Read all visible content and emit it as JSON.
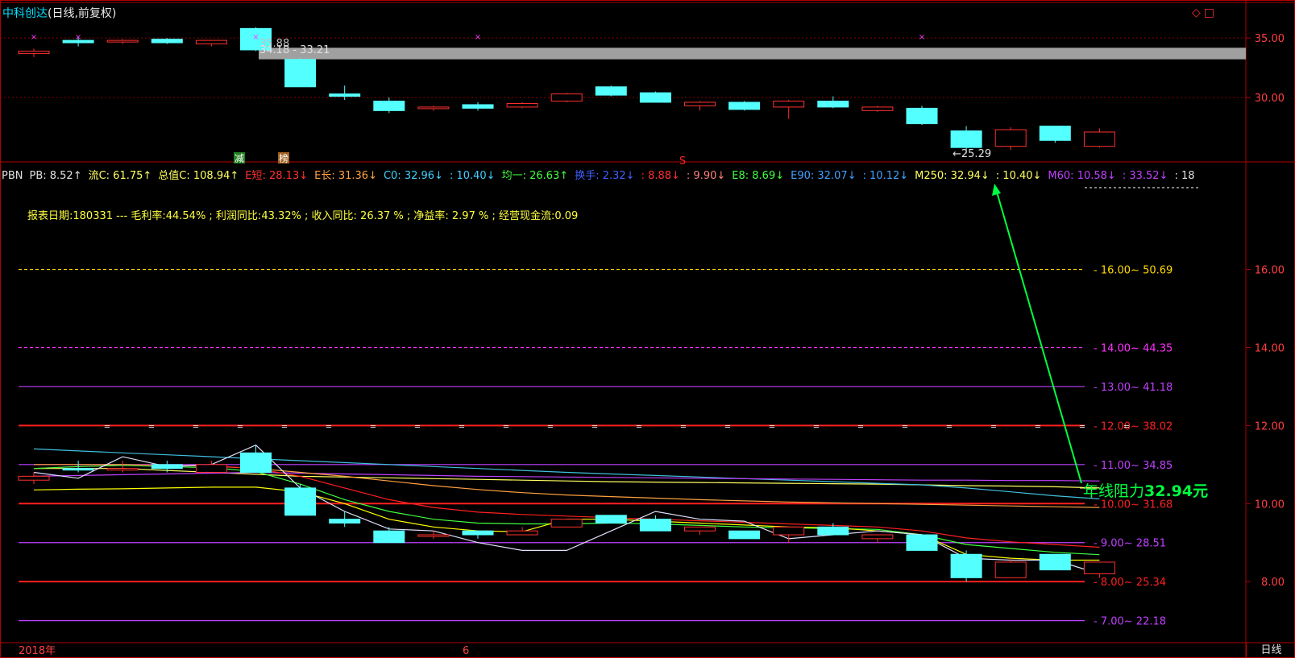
{
  "header": {
    "stock_name": "中科创达",
    "chart_mode": "(日线,前复权)",
    "icons": [
      "diamond-icon",
      "square-icon"
    ]
  },
  "price_scale": {
    "upper_ticks": [
      "35.00",
      "30.00"
    ],
    "lower_ticks": [
      "16.00",
      "14.00",
      "12.00",
      "10.00",
      "8.00"
    ]
  },
  "indicators": [
    {
      "text": "PBN",
      "color": "#e0e0e0"
    },
    {
      "text": "PB: 8.52↑",
      "color": "#e0e0e0"
    },
    {
      "text": "流C: 61.75↑",
      "color": "#ffff60"
    },
    {
      "text": "总值C: 108.94↑",
      "color": "#ffff60"
    },
    {
      "text": "E短: 28.13↓",
      "color": "#ff3030"
    },
    {
      "text": "E长: 31.36↓",
      "color": "#ffa040"
    },
    {
      "text": "C0: 32.96↓",
      "color": "#40d0ff"
    },
    {
      "text": ": 10.40↓",
      "color": "#40d0ff"
    },
    {
      "text": "均一: 26.63↑",
      "color": "#40ff40"
    },
    {
      "text": "换手: 2.32↓",
      "color": "#4060ff"
    },
    {
      "text": ": 8.88↓",
      "color": "#ff3030"
    },
    {
      "text": ": 9.90↓",
      "color": "#ff8080"
    },
    {
      "text": "E8: 8.69↓",
      "color": "#40ff40"
    },
    {
      "text": "E90: 32.07↓",
      "color": "#40a0ff"
    },
    {
      "text": ": 10.12↓",
      "color": "#40a0ff"
    },
    {
      "text": "M250: 32.94↓",
      "color": "#ffff60"
    },
    {
      "text": ": 10.40↓",
      "color": "#ffff60"
    },
    {
      "text": "M60: 10.58↓",
      "color": "#c040ff"
    },
    {
      "text": ": 33.52↓",
      "color": "#c040ff"
    },
    {
      "text": ": 18",
      "color": "#e0e0e0"
    }
  ],
  "report_line": "报表日期:180331 --- 毛利率:44.54% ; 利润同比:43.32% ; 收入同比: 26.37 % ; 净益率: 2.97 % ; 经营现金流:0.09",
  "annotation": {
    "prefix": "年线阻力",
    "value": "32.94元"
  },
  "marks": {
    "reduce": "减",
    "rank": "榜",
    "signal": "S"
  },
  "price_labels": {
    "high": "35.88",
    "range": "34.18 - 33.21",
    "low": "←25.29"
  },
  "time_axis": {
    "year": "2018年",
    "month": "6"
  },
  "period_button": "日线",
  "level_lines": [
    {
      "label": "16.00~ 50.69",
      "color": "#ffd700",
      "style": "dashed"
    },
    {
      "label": "14.00~ 44.35",
      "color": "#ff30ff",
      "style": "dashed"
    },
    {
      "label": "13.00~ 41.18",
      "color": "#c040ff",
      "style": "solid"
    },
    {
      "label": "12.00~ 38.02",
      "color": "#ff2020",
      "style": "solid"
    },
    {
      "label": "11.00~ 34.85",
      "color": "#c040ff",
      "style": "solid"
    },
    {
      "label": "10.00~ 31.68",
      "color": "#ff2020",
      "style": "solid"
    },
    {
      "label": "9.00~ 28.51",
      "color": "#c040ff",
      "style": "solid"
    },
    {
      "label": "8.00~ 25.34",
      "color": "#ff2020",
      "style": "solid"
    },
    {
      "label": "7.00~ 22.18",
      "color": "#c040ff",
      "style": "solid"
    }
  ],
  "chart_data": [
    {
      "type": "candlestick",
      "panel": "price",
      "ylim": [
        25,
        36.5
      ],
      "candles": [
        {
          "o": 33.9,
          "h": 34.1,
          "l": 33.4,
          "c": 33.7,
          "dir": "up"
        },
        {
          "o": 34.8,
          "h": 35.0,
          "l": 34.3,
          "c": 34.6,
          "dir": "down"
        },
        {
          "o": 34.8,
          "h": 34.9,
          "l": 34.5,
          "c": 34.7,
          "dir": "up"
        },
        {
          "o": 34.9,
          "h": 35.0,
          "l": 34.5,
          "c": 34.6,
          "dir": "down"
        },
        {
          "o": 34.5,
          "h": 34.8,
          "l": 34.3,
          "c": 34.8,
          "dir": "up"
        },
        {
          "o": 35.8,
          "h": 35.9,
          "l": 33.9,
          "c": 34.0,
          "dir": "down"
        },
        {
          "o": 33.2,
          "h": 33.3,
          "l": 30.9,
          "c": 30.9,
          "dir": "down"
        },
        {
          "o": 30.3,
          "h": 31.0,
          "l": 29.8,
          "c": 30.1,
          "dir": "down"
        },
        {
          "o": 29.7,
          "h": 30.0,
          "l": 28.7,
          "c": 28.9,
          "dir": "down"
        },
        {
          "o": 29.1,
          "h": 29.3,
          "l": 28.9,
          "c": 29.2,
          "dir": "up"
        },
        {
          "o": 29.4,
          "h": 29.6,
          "l": 28.9,
          "c": 29.1,
          "dir": "down"
        },
        {
          "o": 29.2,
          "h": 29.6,
          "l": 29.1,
          "c": 29.5,
          "dir": "up"
        },
        {
          "o": 29.7,
          "h": 30.4,
          "l": 29.6,
          "c": 30.3,
          "dir": "up"
        },
        {
          "o": 30.9,
          "h": 31.0,
          "l": 30.1,
          "c": 30.2,
          "dir": "down"
        },
        {
          "o": 30.4,
          "h": 30.5,
          "l": 29.6,
          "c": 29.6,
          "dir": "down"
        },
        {
          "o": 29.3,
          "h": 29.7,
          "l": 28.9,
          "c": 29.6,
          "dir": "up"
        },
        {
          "o": 29.6,
          "h": 29.7,
          "l": 28.9,
          "c": 29.0,
          "dir": "down"
        },
        {
          "o": 29.2,
          "h": 29.8,
          "l": 28.2,
          "c": 29.7,
          "dir": "up"
        },
        {
          "o": 29.7,
          "h": 30.1,
          "l": 29.1,
          "c": 29.2,
          "dir": "down"
        },
        {
          "o": 28.9,
          "h": 29.3,
          "l": 28.8,
          "c": 29.2,
          "dir": "up"
        },
        {
          "o": 29.1,
          "h": 29.3,
          "l": 27.7,
          "c": 27.8,
          "dir": "down"
        },
        {
          "o": 27.2,
          "h": 27.6,
          "l": 25.3,
          "c": 25.8,
          "dir": "down"
        },
        {
          "o": 25.9,
          "h": 27.5,
          "l": 25.6,
          "c": 27.3,
          "dir": "up"
        },
        {
          "o": 27.6,
          "h": 27.6,
          "l": 26.2,
          "c": 26.4,
          "dir": "down"
        },
        {
          "o": 25.9,
          "h": 27.4,
          "l": 25.8,
          "c": 27.1,
          "dir": "up"
        }
      ],
      "series": [
        {
          "name": "M250",
          "values": [
            33.21,
            34.18
          ]
        }
      ]
    },
    {
      "type": "candlestick",
      "panel": "pb",
      "ylim": [
        6.6,
        18.2
      ],
      "candles": [
        {
          "o": 10.6,
          "h": 10.8,
          "l": 10.5,
          "c": 10.7,
          "dir": "up"
        },
        {
          "o": 10.9,
          "h": 11.1,
          "l": 10.8,
          "c": 10.9,
          "dir": "down"
        },
        {
          "o": 10.9,
          "h": 11.1,
          "l": 10.8,
          "c": 10.9,
          "dir": "up"
        },
        {
          "o": 11.0,
          "h": 11.1,
          "l": 10.8,
          "c": 10.9,
          "dir": "down"
        },
        {
          "o": 10.8,
          "h": 11.1,
          "l": 10.8,
          "c": 11.0,
          "dir": "up"
        },
        {
          "o": 11.3,
          "h": 11.5,
          "l": 10.8,
          "c": 10.8,
          "dir": "down"
        },
        {
          "o": 10.4,
          "h": 10.5,
          "l": 9.7,
          "c": 9.7,
          "dir": "down"
        },
        {
          "o": 9.6,
          "h": 9.8,
          "l": 9.4,
          "c": 9.5,
          "dir": "down"
        },
        {
          "o": 9.3,
          "h": 9.4,
          "l": 9.0,
          "c": 9.0,
          "dir": "down"
        },
        {
          "o": 9.2,
          "h": 9.3,
          "l": 9.1,
          "c": 9.2,
          "dir": "up"
        },
        {
          "o": 9.3,
          "h": 9.3,
          "l": 9.1,
          "c": 9.2,
          "dir": "down"
        },
        {
          "o": 9.2,
          "h": 9.4,
          "l": 9.2,
          "c": 9.3,
          "dir": "up"
        },
        {
          "o": 9.4,
          "h": 9.6,
          "l": 9.4,
          "c": 9.6,
          "dir": "up"
        },
        {
          "o": 9.7,
          "h": 9.7,
          "l": 9.5,
          "c": 9.5,
          "dir": "down"
        },
        {
          "o": 9.6,
          "h": 9.7,
          "l": 9.3,
          "c": 9.3,
          "dir": "down"
        },
        {
          "o": 9.3,
          "h": 9.4,
          "l": 9.2,
          "c": 9.4,
          "dir": "up"
        },
        {
          "o": 9.3,
          "h": 9.3,
          "l": 9.1,
          "c": 9.1,
          "dir": "down"
        },
        {
          "o": 9.2,
          "h": 9.4,
          "l": 9.0,
          "c": 9.4,
          "dir": "up"
        },
        {
          "o": 9.4,
          "h": 9.5,
          "l": 9.2,
          "c": 9.2,
          "dir": "down"
        },
        {
          "o": 9.1,
          "h": 9.2,
          "l": 9.0,
          "c": 9.2,
          "dir": "up"
        },
        {
          "o": 9.2,
          "h": 9.2,
          "l": 8.8,
          "c": 8.8,
          "dir": "down"
        },
        {
          "o": 8.7,
          "h": 8.8,
          "l": 8.0,
          "c": 8.1,
          "dir": "down"
        },
        {
          "o": 8.1,
          "h": 8.6,
          "l": 8.1,
          "c": 8.5,
          "dir": "up"
        },
        {
          "o": 8.7,
          "h": 8.7,
          "l": 8.3,
          "c": 8.3,
          "dir": "down"
        },
        {
          "o": 8.2,
          "h": 8.5,
          "l": 8.1,
          "c": 8.5,
          "dir": "up"
        }
      ],
      "series": [
        {
          "name": "M250",
          "values": [
            10.9,
            10.9,
            10.9,
            10.85,
            10.8,
            10.75,
            10.7,
            10.68,
            10.66,
            10.64,
            10.62,
            10.6,
            10.58,
            10.56,
            10.55,
            10.54,
            10.53,
            10.52,
            10.51,
            10.5,
            10.48,
            10.46,
            10.45,
            10.43,
            10.4
          ]
        },
        {
          "name": "E90",
          "values": [
            11.4,
            11.35,
            11.3,
            11.25,
            11.2,
            11.15,
            11.1,
            11.05,
            11.0,
            10.95,
            10.9,
            10.85,
            10.8,
            10.76,
            10.72,
            10.68,
            10.64,
            10.6,
            10.56,
            10.52,
            10.48,
            10.4,
            10.3,
            10.2,
            10.12
          ]
        },
        {
          "name": "M60",
          "values": [
            10.7,
            10.72,
            10.74,
            10.76,
            10.78,
            10.8,
            10.78,
            10.76,
            10.74,
            10.72,
            10.7,
            10.69,
            10.68,
            10.67,
            10.66,
            10.65,
            10.64,
            10.63,
            10.62,
            10.61,
            10.6,
            10.6,
            10.59,
            10.59,
            10.58
          ]
        },
        {
          "name": "E长",
          "values": [
            11.0,
            11.0,
            11.0,
            10.98,
            10.96,
            10.9,
            10.8,
            10.7,
            10.58,
            10.46,
            10.36,
            10.28,
            10.22,
            10.18,
            10.14,
            10.1,
            10.07,
            10.04,
            10.02,
            10.0,
            9.98,
            9.96,
            9.94,
            9.92,
            9.9
          ]
        },
        {
          "name": "E短",
          "values": [
            10.9,
            10.95,
            10.98,
            10.98,
            10.97,
            10.9,
            10.7,
            10.4,
            10.1,
            9.9,
            9.78,
            9.72,
            9.68,
            9.64,
            9.6,
            9.56,
            9.52,
            9.48,
            9.44,
            9.4,
            9.3,
            9.12,
            9.02,
            8.95,
            8.88
          ]
        },
        {
          "name": "E8",
          "values": [
            10.9,
            10.95,
            10.98,
            10.95,
            10.92,
            10.82,
            10.5,
            10.1,
            9.8,
            9.6,
            9.5,
            9.48,
            9.48,
            9.5,
            9.48,
            9.44,
            9.4,
            9.38,
            9.36,
            9.34,
            9.2,
            8.95,
            8.85,
            8.75,
            8.69
          ]
        },
        {
          "name": "均一",
          "values": [
            10.35,
            10.37,
            10.38,
            10.4,
            10.42,
            10.42,
            10.3,
            10.0,
            9.6,
            9.4,
            9.3,
            9.28,
            9.6,
            9.6,
            9.55,
            9.5,
            9.45,
            9.4,
            9.38,
            9.3,
            9.2,
            8.7,
            8.6,
            8.55,
            8.55
          ]
        },
        {
          "name": "C0",
          "values": [
            10.8,
            10.65,
            11.2,
            10.95,
            11.0,
            11.5,
            10.4,
            9.8,
            9.35,
            9.3,
            9.0,
            8.8,
            8.8,
            9.3,
            9.8,
            9.6,
            9.55,
            9.1,
            9.2,
            9.3,
            9.2,
            8.6,
            8.55,
            8.55,
            8.2
          ]
        }
      ]
    }
  ]
}
